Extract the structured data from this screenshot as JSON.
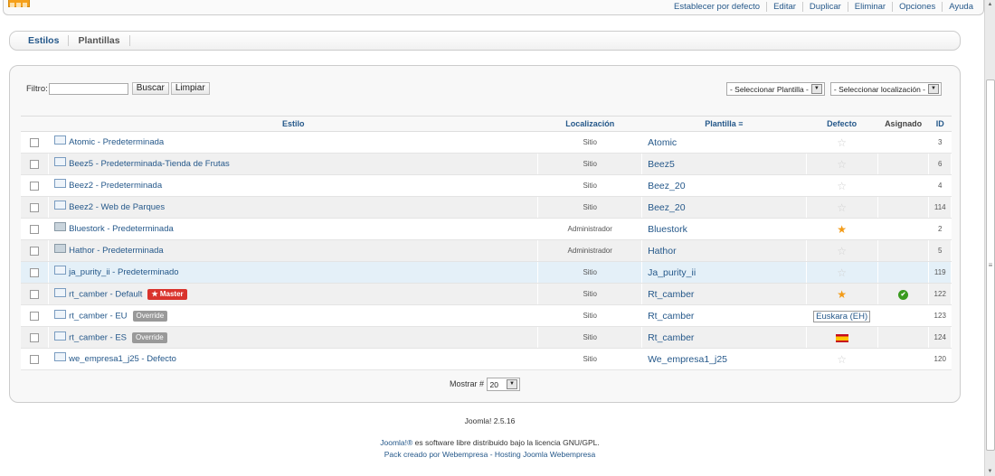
{
  "toolbar": {
    "actions": [
      "Establecer por defecto",
      "Editar",
      "Duplicar",
      "Eliminar",
      "Opciones",
      "Ayuda"
    ]
  },
  "tabs": [
    "Estilos",
    "Plantillas"
  ],
  "filter": {
    "label": "Filtro:",
    "value": "",
    "search_button": "Buscar",
    "clear_button": "Limpiar",
    "template_select": "- Seleccionar Plantilla -",
    "location_select": "- Seleccionar localización -"
  },
  "columns": {
    "estilo": "Estilo",
    "localizacion": "Localización",
    "plantilla": "Plantilla",
    "defecto": "Defecto",
    "asignado": "Asignado",
    "id": "ID"
  },
  "rows": [
    {
      "estilo": "Atomic - Predeterminada",
      "loc": "Sitio",
      "plantilla": "Atomic",
      "defecto": "off",
      "asignado": false,
      "id": "3"
    },
    {
      "estilo": "Beez5 - Predeterminada-Tienda de Frutas",
      "loc": "Sitio",
      "plantilla": "Beez5",
      "defecto": "off",
      "asignado": false,
      "id": "6"
    },
    {
      "estilo": "Beez2 - Predeterminada",
      "loc": "Sitio",
      "plantilla": "Beez_20",
      "defecto": "off",
      "asignado": false,
      "id": "4"
    },
    {
      "estilo": "Beez2 - Web de Parques",
      "loc": "Sitio",
      "plantilla": "Beez_20",
      "defecto": "off",
      "asignado": false,
      "id": "114"
    },
    {
      "estilo": "Bluestork - Predeterminada",
      "loc": "Administrador",
      "plantilla": "Bluestork",
      "defecto": "on",
      "asignado": false,
      "id": "2"
    },
    {
      "estilo": "Hathor - Predeterminada",
      "loc": "Administrador",
      "plantilla": "Hathor",
      "defecto": "off",
      "asignado": false,
      "id": "5"
    },
    {
      "estilo": "ja_purity_ii - Predeterminado",
      "loc": "Sitio",
      "plantilla": "Ja_purity_ii",
      "defecto": "off",
      "asignado": false,
      "id": "119"
    },
    {
      "estilo": "rt_camber - Default",
      "badge": "Master",
      "loc": "Sitio",
      "plantilla": "Rt_camber",
      "defecto": "on",
      "asignado": true,
      "id": "122"
    },
    {
      "estilo": "rt_camber - EU",
      "badge": "Override",
      "loc": "Sitio",
      "plantilla": "Rt_camber",
      "defecto": "Euskara (EH)",
      "asignado": false,
      "id": "123"
    },
    {
      "estilo": "rt_camber - ES",
      "badge": "Override",
      "loc": "Sitio",
      "plantilla": "Rt_camber",
      "defecto": "flag-es",
      "asignado": false,
      "id": "124"
    },
    {
      "estilo": "we_empresa1_j25 - Defecto",
      "loc": "Sitio",
      "plantilla": "We_empresa1_j25",
      "defecto": "off",
      "asignado": false,
      "id": "120"
    }
  ],
  "pager": {
    "label": "Mostrar #",
    "value": "20"
  },
  "footer": {
    "version": "Joomla! 2.5.16",
    "license_link": "Joomla!®",
    "license_text": " es software libre distribuido bajo la licencia GNU/GPL.",
    "pack_text": "Pack creado por Webempresa - Hosting Joomla Webempresa"
  },
  "colors": {
    "link": "#25588a",
    "star_on": "#f39b17",
    "master_badge": "#d9332c",
    "assigned": "#3a9b1f"
  }
}
